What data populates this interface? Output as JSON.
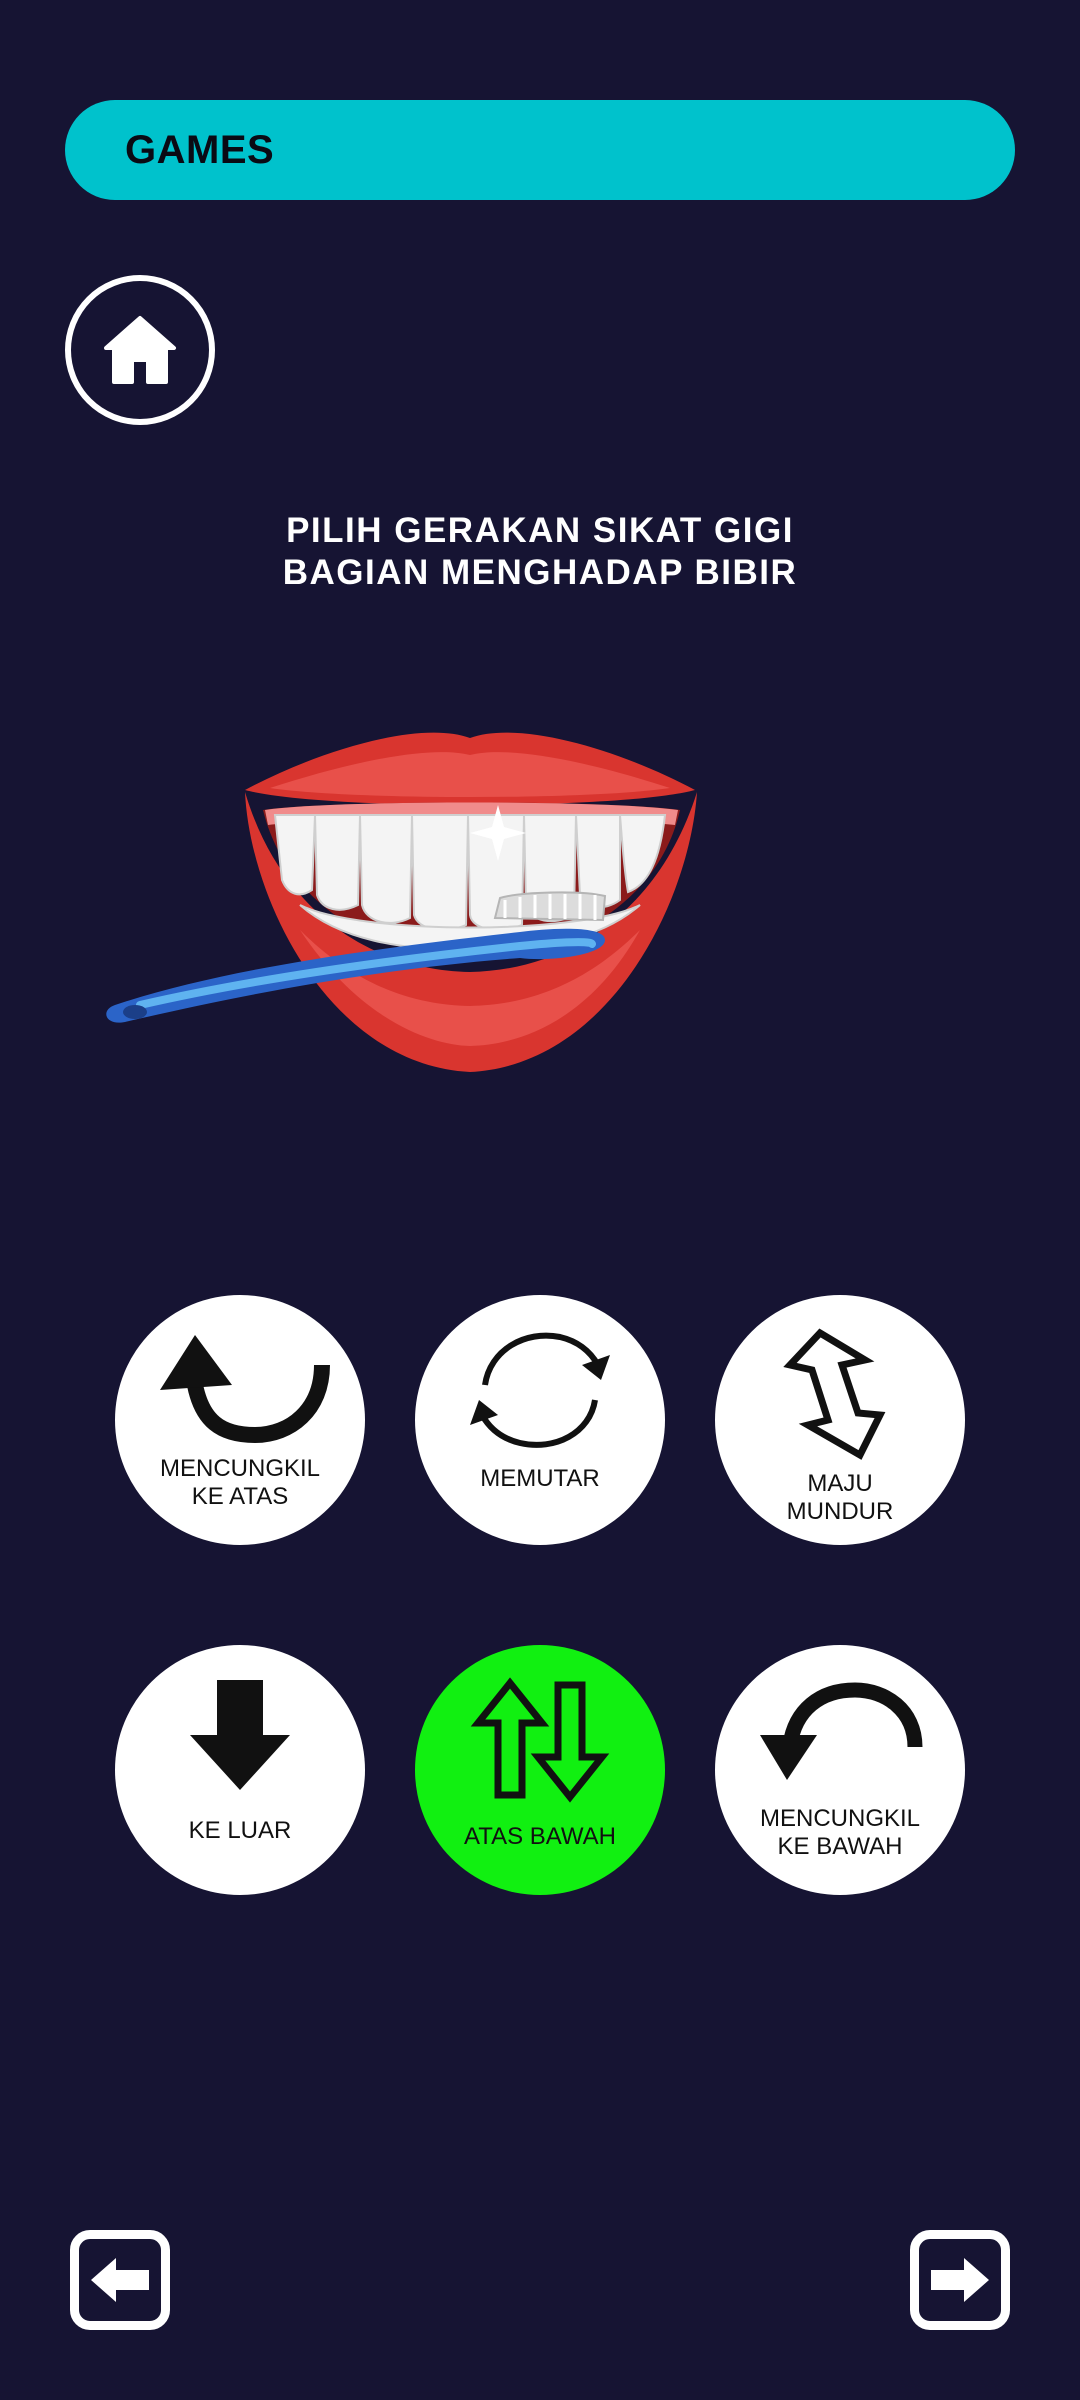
{
  "header": {
    "title": "GAMES"
  },
  "instruction": {
    "line1": "PILIH GERAKAN SIKAT GIGI",
    "line2": "BAGIAN MENGHADAP BIBIR"
  },
  "choices": [
    {
      "label": "MENCUNGKIL\nKE ATAS",
      "icon": "curved-arrow-up-icon",
      "selected": false
    },
    {
      "label": "MEMUTAR",
      "icon": "rotate-icon",
      "selected": false
    },
    {
      "label": "MAJU\nMUNDUR",
      "icon": "back-forth-arrow-icon",
      "selected": false
    },
    {
      "label": "KE LUAR",
      "icon": "arrow-down-icon",
      "selected": false
    },
    {
      "label": "ATAS BAWAH",
      "icon": "up-down-arrows-icon",
      "selected": true
    },
    {
      "label": "MENCUNGKIL\nKE BAWAH",
      "icon": "curved-arrow-down-icon",
      "selected": false
    }
  ],
  "colors": {
    "background": "#161433",
    "header": "#00c2cc",
    "selected": "#11f011"
  }
}
